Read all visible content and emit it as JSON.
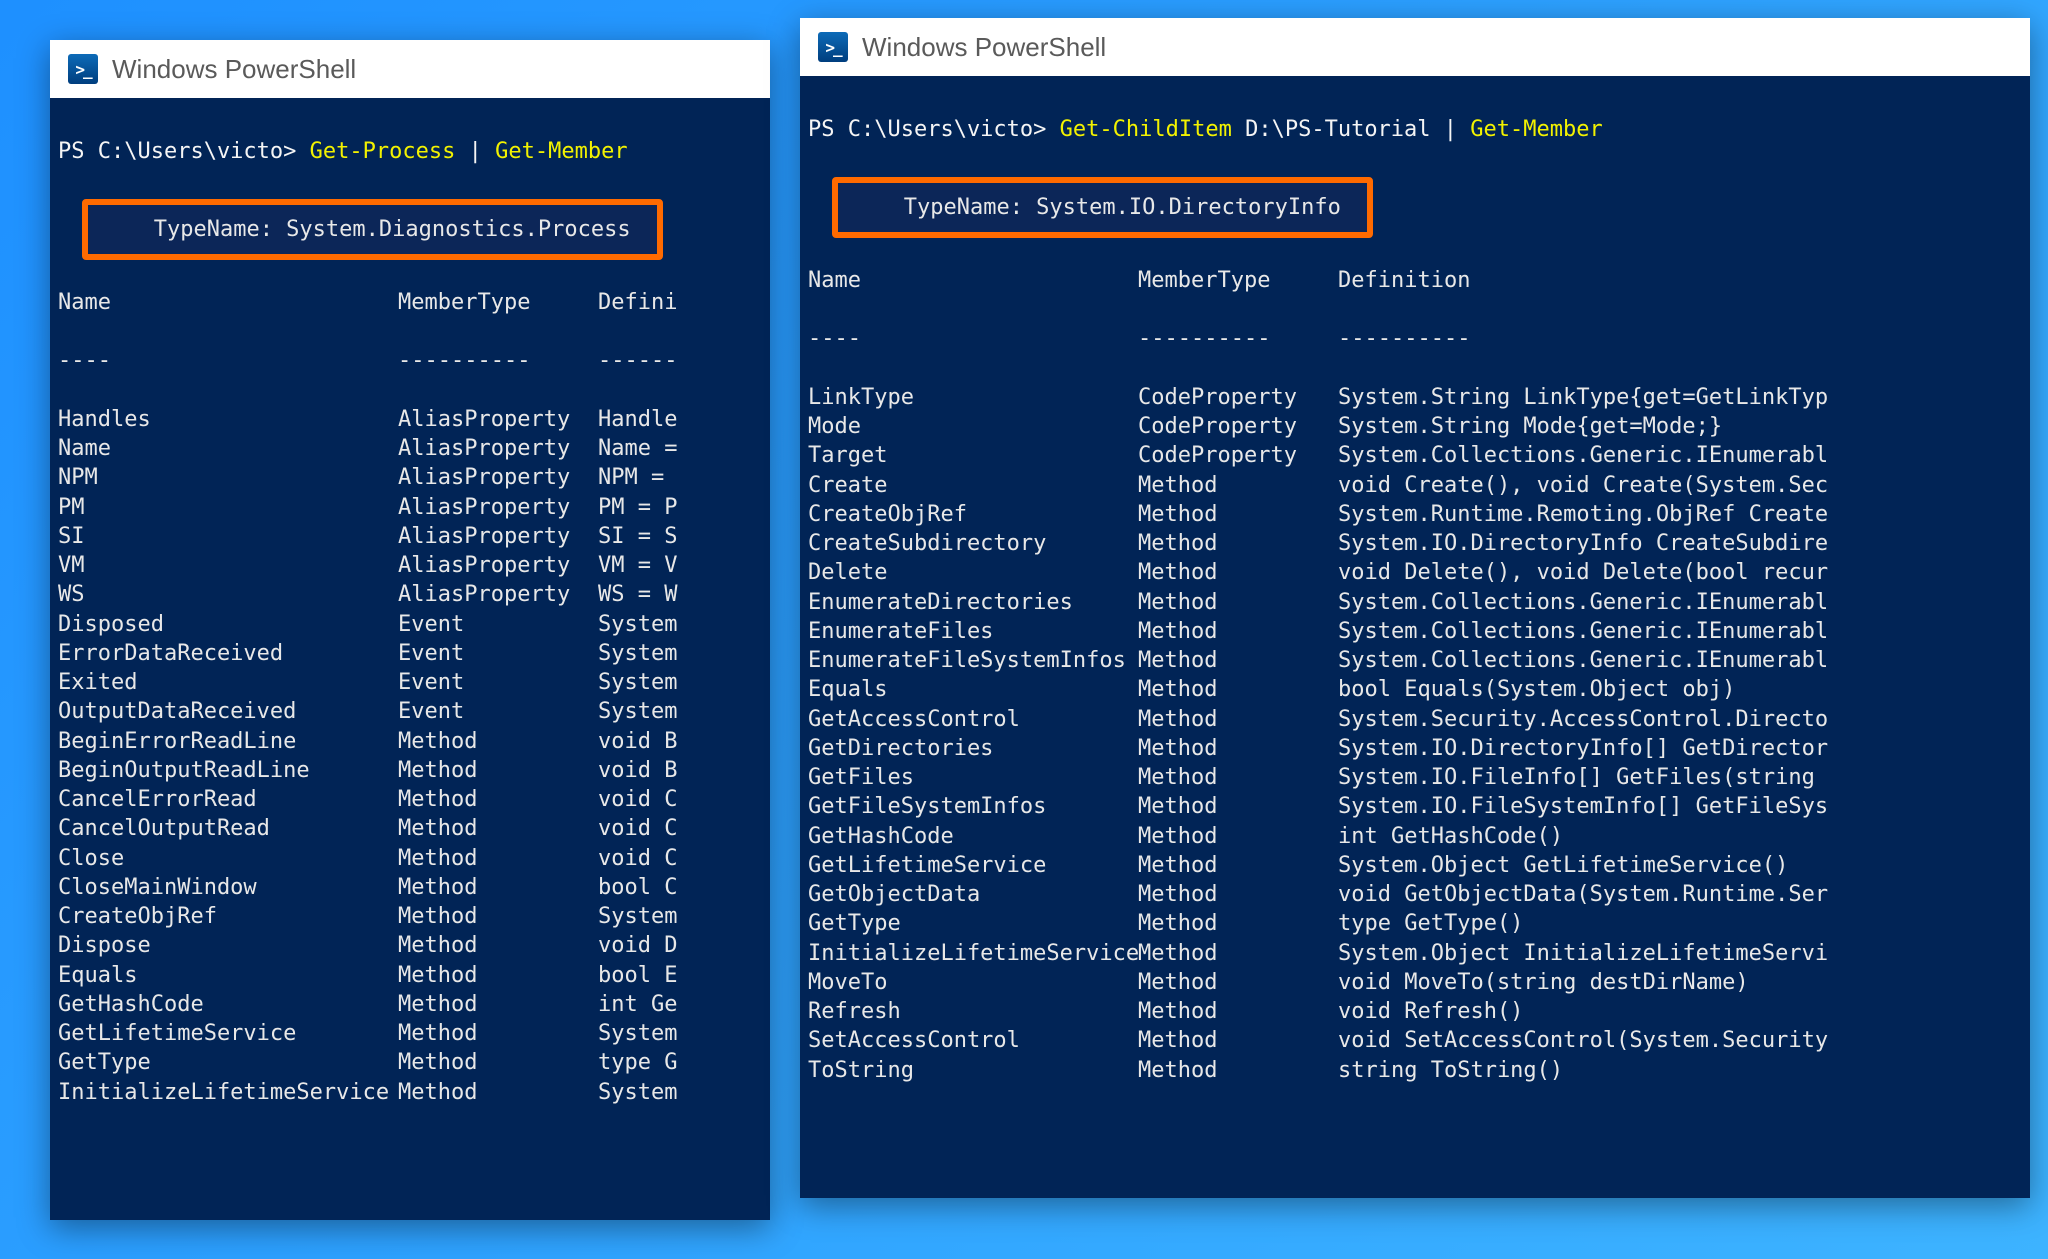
{
  "left": {
    "title": "Windows PowerShell",
    "prompt": "PS C:\\Users\\victo>",
    "cmd1": "Get-Process",
    "pipe": "|",
    "cmd2": "Get-Member",
    "typename": "   TypeName: System.Diagnostics.Process",
    "headers": {
      "c1": "Name",
      "c2": "MemberType",
      "c3": "Defini"
    },
    "dashes": {
      "c1": "----",
      "c2": "----------",
      "c3": "------"
    },
    "rows": [
      {
        "c1": "Handles",
        "c2": "AliasProperty",
        "c3": "Handle"
      },
      {
        "c1": "Name",
        "c2": "AliasProperty",
        "c3": "Name ="
      },
      {
        "c1": "NPM",
        "c2": "AliasProperty",
        "c3": "NPM = "
      },
      {
        "c1": "PM",
        "c2": "AliasProperty",
        "c3": "PM = P"
      },
      {
        "c1": "SI",
        "c2": "AliasProperty",
        "c3": "SI = S"
      },
      {
        "c1": "VM",
        "c2": "AliasProperty",
        "c3": "VM = V"
      },
      {
        "c1": "WS",
        "c2": "AliasProperty",
        "c3": "WS = W"
      },
      {
        "c1": "Disposed",
        "c2": "Event",
        "c3": "System"
      },
      {
        "c1": "ErrorDataReceived",
        "c2": "Event",
        "c3": "System"
      },
      {
        "c1": "Exited",
        "c2": "Event",
        "c3": "System"
      },
      {
        "c1": "OutputDataReceived",
        "c2": "Event",
        "c3": "System"
      },
      {
        "c1": "BeginErrorReadLine",
        "c2": "Method",
        "c3": "void B"
      },
      {
        "c1": "BeginOutputReadLine",
        "c2": "Method",
        "c3": "void B"
      },
      {
        "c1": "CancelErrorRead",
        "c2": "Method",
        "c3": "void C"
      },
      {
        "c1": "CancelOutputRead",
        "c2": "Method",
        "c3": "void C"
      },
      {
        "c1": "Close",
        "c2": "Method",
        "c3": "void C"
      },
      {
        "c1": "CloseMainWindow",
        "c2": "Method",
        "c3": "bool C"
      },
      {
        "c1": "CreateObjRef",
        "c2": "Method",
        "c3": "System"
      },
      {
        "c1": "Dispose",
        "c2": "Method",
        "c3": "void D"
      },
      {
        "c1": "Equals",
        "c2": "Method",
        "c3": "bool E"
      },
      {
        "c1": "GetHashCode",
        "c2": "Method",
        "c3": "int Ge"
      },
      {
        "c1": "GetLifetimeService",
        "c2": "Method",
        "c3": "System"
      },
      {
        "c1": "GetType",
        "c2": "Method",
        "c3": "type G"
      },
      {
        "c1": "InitializeLifetimeService",
        "c2": "Method",
        "c3": "System"
      }
    ]
  },
  "right": {
    "title": "Windows PowerShell",
    "prompt": "PS C:\\Users\\victo>",
    "cmd1": "Get-ChildItem",
    "path": "D:\\PS-Tutorial",
    "pipe": "|",
    "cmd2": "Get-Member",
    "typename": "   TypeName: System.IO.DirectoryInfo",
    "headers": {
      "c1": "Name",
      "c2": "MemberType",
      "c3": "Definition"
    },
    "dashes": {
      "c1": "----",
      "c2": "----------",
      "c3": "----------"
    },
    "rows": [
      {
        "c1": "LinkType",
        "c2": "CodeProperty",
        "c3": "System.String LinkType{get=GetLinkTyp"
      },
      {
        "c1": "Mode",
        "c2": "CodeProperty",
        "c3": "System.String Mode{get=Mode;}"
      },
      {
        "c1": "Target",
        "c2": "CodeProperty",
        "c3": "System.Collections.Generic.IEnumerabl"
      },
      {
        "c1": "Create",
        "c2": "Method",
        "c3": "void Create(), void Create(System.Sec"
      },
      {
        "c1": "CreateObjRef",
        "c2": "Method",
        "c3": "System.Runtime.Remoting.ObjRef Create"
      },
      {
        "c1": "CreateSubdirectory",
        "c2": "Method",
        "c3": "System.IO.DirectoryInfo CreateSubdire"
      },
      {
        "c1": "Delete",
        "c2": "Method",
        "c3": "void Delete(), void Delete(bool recur"
      },
      {
        "c1": "EnumerateDirectories",
        "c2": "Method",
        "c3": "System.Collections.Generic.IEnumerabl"
      },
      {
        "c1": "EnumerateFiles",
        "c2": "Method",
        "c3": "System.Collections.Generic.IEnumerabl"
      },
      {
        "c1": "EnumerateFileSystemInfos",
        "c2": "Method",
        "c3": "System.Collections.Generic.IEnumerabl"
      },
      {
        "c1": "Equals",
        "c2": "Method",
        "c3": "bool Equals(System.Object obj)"
      },
      {
        "c1": "GetAccessControl",
        "c2": "Method",
        "c3": "System.Security.AccessControl.Directo"
      },
      {
        "c1": "GetDirectories",
        "c2": "Method",
        "c3": "System.IO.DirectoryInfo[] GetDirector"
      },
      {
        "c1": "GetFiles",
        "c2": "Method",
        "c3": "System.IO.FileInfo[] GetFiles(string "
      },
      {
        "c1": "GetFileSystemInfos",
        "c2": "Method",
        "c3": "System.IO.FileSystemInfo[] GetFileSys"
      },
      {
        "c1": "GetHashCode",
        "c2": "Method",
        "c3": "int GetHashCode()"
      },
      {
        "c1": "GetLifetimeService",
        "c2": "Method",
        "c3": "System.Object GetLifetimeService()"
      },
      {
        "c1": "GetObjectData",
        "c2": "Method",
        "c3": "void GetObjectData(System.Runtime.Ser"
      },
      {
        "c1": "GetType",
        "c2": "Method",
        "c3": "type GetType()"
      },
      {
        "c1": "InitializeLifetimeService",
        "c2": "Method",
        "c3": "System.Object InitializeLifetimeServi"
      },
      {
        "c1": "MoveTo",
        "c2": "Method",
        "c3": "void MoveTo(string destDirName)"
      },
      {
        "c1": "Refresh",
        "c2": "Method",
        "c3": "void Refresh()"
      },
      {
        "c1": "SetAccessControl",
        "c2": "Method",
        "c3": "void SetAccessControl(System.Security"
      },
      {
        "c1": "ToString",
        "c2": "Method",
        "c3": "string ToString()"
      }
    ]
  }
}
